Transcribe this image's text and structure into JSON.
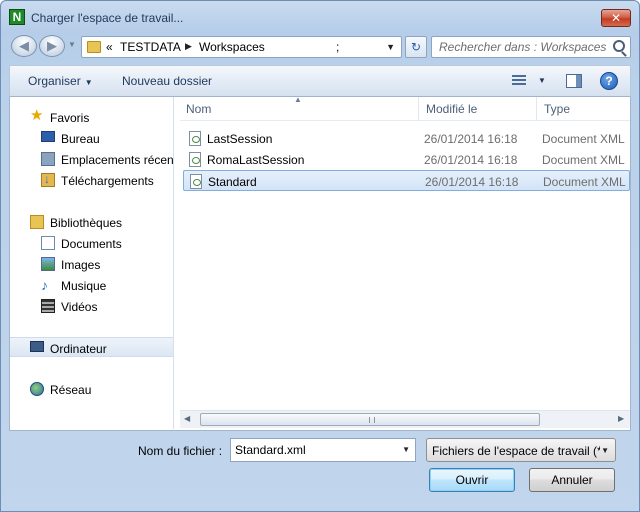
{
  "window": {
    "title": "Charger l'espace de travail...",
    "app_icon_letter": "N",
    "close_glyph": "✕"
  },
  "nav": {
    "back_glyph": "◀",
    "forward_glyph": "▶",
    "history_glyph": "▼",
    "address": {
      "prefix": "«",
      "segments": [
        "TESTDATA",
        "Workspaces"
      ],
      "separator_glyph": "▶",
      "trailing": ";",
      "dropdown_glyph": "▼"
    },
    "refresh_glyph": "↻",
    "search_placeholder": "Rechercher dans : Workspaces"
  },
  "toolbar": {
    "organise_label": "Organiser",
    "organise_caret": "▼",
    "new_folder_label": "Nouveau dossier",
    "view_caret": "▼",
    "help_glyph": "?"
  },
  "sidebar": {
    "favorites": {
      "label": "Favoris",
      "items": [
        "Bureau",
        "Emplacements récents",
        "Téléchargements"
      ]
    },
    "libraries": {
      "label": "Bibliothèques",
      "items": [
        "Documents",
        "Images",
        "Musique",
        "Vidéos"
      ]
    },
    "computer_label": "Ordinateur",
    "network_label": "Réseau"
  },
  "file_list": {
    "columns": [
      "Nom",
      "Modifié le",
      "Type"
    ],
    "sort_glyph": "▲",
    "rows": [
      {
        "name": "LastSession",
        "modified": "26/01/2014 16:18",
        "type": "Document XML"
      },
      {
        "name": "RomaLastSession",
        "modified": "26/01/2014 16:18",
        "type": "Document XML"
      },
      {
        "name": "Standard",
        "modified": "26/01/2014 16:18",
        "type": "Document XML"
      }
    ],
    "selected_index": 2,
    "scroll_left_glyph": "◀",
    "scroll_right_glyph": "▶"
  },
  "footer": {
    "filename_label": "Nom du fichier :",
    "filename_value": "Standard.xml",
    "filename_dropdown_glyph": "▼",
    "filter_value": "Fichiers de l'espace de travail (*",
    "filter_dropdown_glyph": "▼",
    "open_label": "Ouvrir",
    "cancel_label": "Annuler"
  }
}
